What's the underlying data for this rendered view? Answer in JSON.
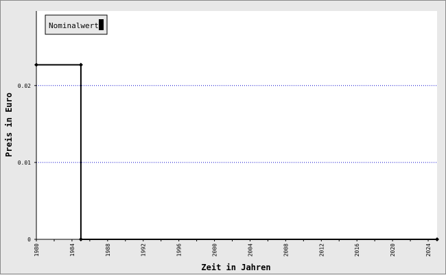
{
  "chart_data": {
    "type": "line",
    "xlabel": "Zeit in Jahren",
    "ylabel": "Preis in Euro",
    "xlim": [
      1980,
      2025
    ],
    "ylim": [
      0,
      0.0297
    ],
    "x_ticks": [
      "1980",
      "1984",
      "1988",
      "1992",
      "1996",
      "2000",
      "2004",
      "2008",
      "2012",
      "2016",
      "2020",
      "2024"
    ],
    "y_ticks": [
      {
        "value": 0,
        "label": "0"
      },
      {
        "value": 0.01,
        "label": "0.01"
      },
      {
        "value": 0.02,
        "label": "0.02"
      }
    ],
    "grid": "horizontal-dotted",
    "legend_position": "top-left",
    "series": [
      {
        "name": "Nominalwert",
        "color": "#000000",
        "x": [
          1980,
          1985,
          1985,
          2025
        ],
        "y": [
          0.0227,
          0.0227,
          0,
          0
        ],
        "markers": [
          [
            1980,
            0.0227
          ],
          [
            1985,
            0.0227
          ],
          [
            1985,
            0
          ],
          [
            2025,
            0
          ]
        ]
      }
    ],
    "colors": {
      "background": "#e8e8e8",
      "plot_area": "#ffffff",
      "grid": "#0000cc"
    }
  }
}
